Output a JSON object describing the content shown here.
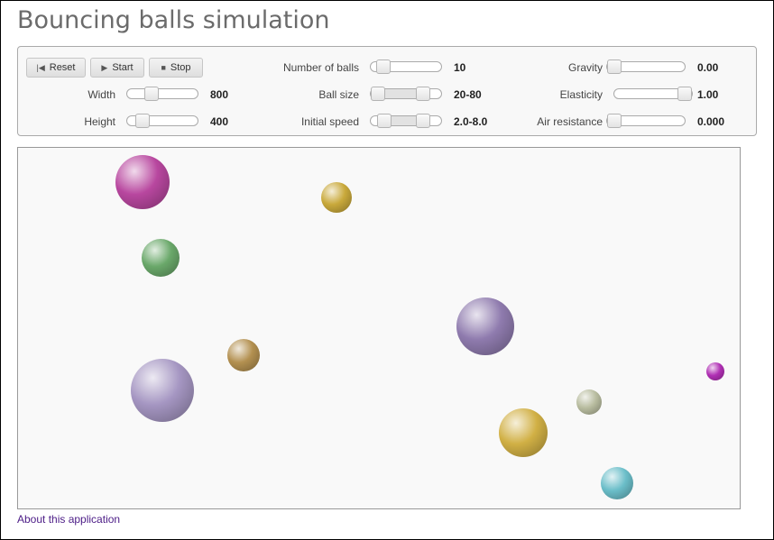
{
  "title": "Bouncing balls simulation",
  "buttons": {
    "reset": {
      "label": "Reset",
      "icon": "skip-back-icon"
    },
    "start": {
      "label": "Start",
      "icon": "play-icon"
    },
    "stop": {
      "label": "Stop",
      "icon": "stop-icon"
    }
  },
  "controls": {
    "width": {
      "label": "Width",
      "value": "800",
      "level": 0.3
    },
    "height": {
      "label": "Height",
      "value": "400",
      "level": 0.15
    },
    "num_balls": {
      "label": "Number of balls",
      "value": "10",
      "level": 0.1
    },
    "ball_size": {
      "label": "Ball size",
      "value": "20-80",
      "range": [
        0,
        0.8
      ]
    },
    "initial_speed": {
      "label": "Initial speed",
      "value": "2.0-8.0",
      "range": [
        0.12,
        0.8
      ]
    },
    "gravity": {
      "label": "Gravity",
      "value": "0.00",
      "level": 0.0
    },
    "elasticity": {
      "label": "Elasticity",
      "value": "1.00",
      "level": 1.0
    },
    "air_resistance": {
      "label": "Air resistance",
      "value": "0.000",
      "level": 0.0
    }
  },
  "balls": [
    {
      "color": "#b8479f"
    },
    {
      "color": "#c9a93b"
    },
    {
      "color": "#6aa86a"
    },
    {
      "color": "#8f7bae"
    },
    {
      "color": "#b39050"
    },
    {
      "color": "#a596c2"
    },
    {
      "color": "#b02fb4"
    },
    {
      "color": "#b9bda0"
    },
    {
      "color": "#d1b045"
    },
    {
      "color": "#6bbec9"
    }
  ],
  "about_link": "About this application"
}
